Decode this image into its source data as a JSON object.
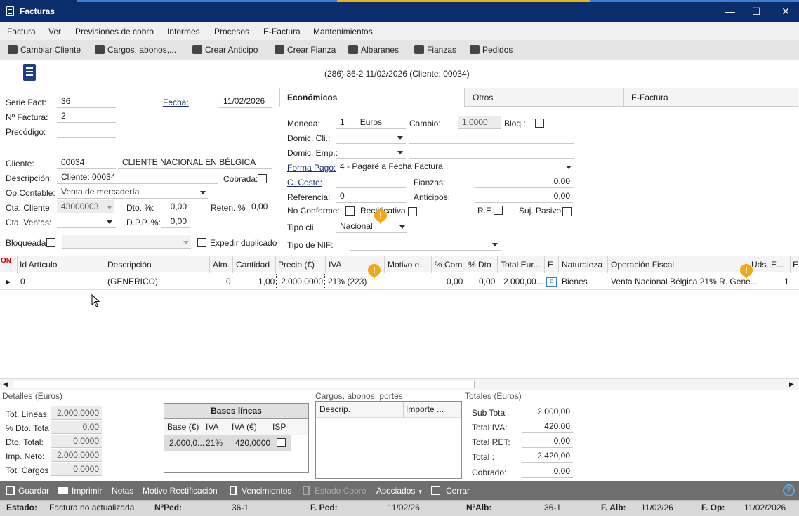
{
  "window": {
    "title": "Facturas",
    "min": "—",
    "max": "☐",
    "close": "✕"
  },
  "menu": [
    "Factura",
    "Ver",
    "Previsiones de cobro",
    "Informes",
    "Procesos",
    "E-Factura",
    "Mantenimientos"
  ],
  "toolbar": [
    "Cambiar Cliente",
    "Cargos, abonos,...",
    "Crear Anticipo",
    "Crear Fianza",
    "Albaranes",
    "Fianzas",
    "Pedidos"
  ],
  "header_info": "(286) 36-2  11/02/2026  (Cliente: 00034)",
  "left": {
    "serie_label": "Serie Fact:",
    "serie": "36",
    "fecha_label": "Fecha:",
    "fecha": "11/02/2026",
    "nfactura_label": "Nº Factura:",
    "nfactura": "2",
    "precodigo_label": "Precódigo:",
    "cliente_label": "Cliente:",
    "cliente_code": "00034",
    "cliente_name": "CLIENTE NACIONAL EN BÉLGICA",
    "descripcion_label": "Descripción:",
    "descripcion": "Cliente: 00034",
    "cobrada_label": "Cobrada:",
    "opcontable_label": "Op.Contable:",
    "opcontable": "Venta de mercadería",
    "ctacliente_label": "Cta. Cliente:",
    "ctacliente": "43000003",
    "dto_label": "Dto. %:",
    "dto": "0,00",
    "reten_label": "Reten. %",
    "reten": "0,00",
    "ctaventas_label": "Cta. Ventas:",
    "dpp_label": "D.P.P. %:",
    "dpp": "0,00",
    "bloqueada_label": "Bloqueada",
    "expedir_label": "Expedir duplicado"
  },
  "tabs": [
    "Económicos",
    "Otros",
    "E-Factura"
  ],
  "eco": {
    "moneda_label": "Moneda:",
    "moneda_code": "1",
    "moneda_name": "Euros",
    "cambio_label": "Cambio:",
    "cambio": "1,0000",
    "bloq_label": "Bloq.:",
    "domcli_label": "Domic. Cli.:",
    "domemp_label": "Domic. Emp.:",
    "formapago_label": "Forma Pago:",
    "formapago": "4 - Pagaré a Fecha Factura",
    "ccoste_label": "C. Coste:",
    "fianzas_label": "Fianzas:",
    "fianzas": "0,00",
    "referencia_label": "Referencia:",
    "referencia": "0",
    "anticipos_label": "Anticipos:",
    "anticipos": "0,00",
    "noconforme_label": "No Conforme:",
    "rectificativa_label": "Rectificativa",
    "re_label": "R.E.",
    "sujpasivo_label": "Suj. Pasivo:",
    "tipocli_label": "Tipo cli",
    "tipocli": "Nacional",
    "tiponif_label": "Tipo de NIF:"
  },
  "grid": {
    "corner": "ON",
    "headers": [
      "Id Artículo",
      "Descripción",
      "Alm.",
      "Cantidad",
      "Precio (€)",
      "IVA",
      "Motivo e...",
      "% Com",
      "% Dto",
      "Total Eur...",
      "E",
      "Naturaleza",
      "Operación Fiscal",
      "Uds. E...",
      "E"
    ],
    "row": {
      "id": "0",
      "desc": "(GENERICO)",
      "alm": "0",
      "cantidad": "1,00",
      "precio": "2.000,0000",
      "iva": "21% (223)",
      "com": "0,00",
      "dto": "0,00",
      "total": "2.000,00...",
      "e": "F",
      "naturaleza": "Bienes",
      "opfiscal": "Venta Nacional Bélgica 21% R. Gene...",
      "uds": "1"
    }
  },
  "detalles": {
    "title": "Detalles (Euros)",
    "rows": [
      {
        "label": "Tot. Líneas:",
        "value": "2.000,0000"
      },
      {
        "label": "% Dto. Tota",
        "value": "0,00"
      },
      {
        "label": "Dto. Total:",
        "value": "0,0000"
      },
      {
        "label": "Imp. Neto:",
        "value": "2.000,0000"
      },
      {
        "label": "Tot. Cargos",
        "value": "0,0000"
      }
    ]
  },
  "bases": {
    "title": "Bases líneas",
    "headers": [
      "Base (€)",
      "IVA",
      "IVA (€)",
      "ISP"
    ],
    "row": [
      "2.000,0...",
      "21%",
      "420,0000"
    ]
  },
  "cargos": {
    "title": "Cargos, abonos, portes",
    "headers": [
      "Descrip.",
      "Importe ..."
    ]
  },
  "totales": {
    "title": "Totales (Euros)",
    "rows": [
      {
        "label": "Sub Total:",
        "value": "2.000,00"
      },
      {
        "label": "Total IVA:",
        "value": "420,00"
      },
      {
        "label": "Total RET:",
        "value": "0,00"
      },
      {
        "label": "Total :",
        "value": "2.420,00"
      },
      {
        "label": "Cobrado:",
        "value": "0,00"
      }
    ]
  },
  "bottom": [
    "Guardar",
    "Imprimir",
    "Notas",
    "Motivo Rectificación",
    "Vencimientos",
    "Estado Cobro",
    "Asociados",
    "Cerrar"
  ],
  "status": {
    "estado_label": "Estado:",
    "estado": "Factura no actualizada",
    "nped_label": "NºPed:",
    "nped": "36-1",
    "fped_label": "F. Ped:",
    "fped": "11/02/26",
    "nalb_label": "NºAlb:",
    "nalb": "36-1",
    "falb_label": "F. Alb:",
    "falb": "11/02/26",
    "fop_label": "F. Op:",
    "fop": "11/02/2026"
  },
  "help": "?"
}
